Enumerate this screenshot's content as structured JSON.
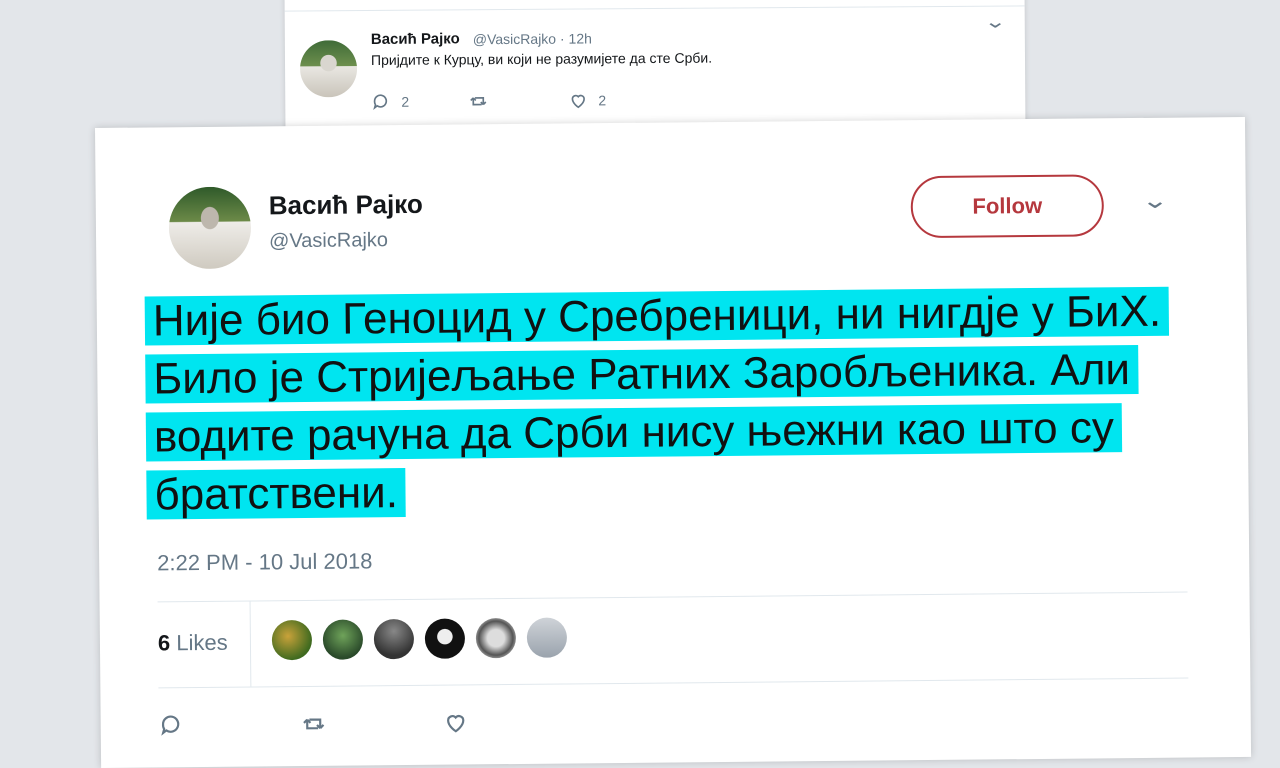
{
  "back_tweet": {
    "name": "Васић Рајко",
    "handle": "@VasicRajko",
    "time": "· 12h",
    "text": "Пријдите к Курцу, ви који не разумијете да сте Срби.",
    "reply_count": "2",
    "like_count": "2",
    "icons": [
      "reply-icon",
      "retweet-icon",
      "heart-icon",
      "chevron-down-icon"
    ]
  },
  "main_tweet": {
    "name": "Васић Рајко",
    "handle": "@VasicRajko",
    "follow_label": "Follow",
    "text": "Није био Геноцид у Сребреници, ни нигдје у БиХ. Било је Стријељање Ратних Заробљеника. Али водите рачуна да Срби нису њежни као што су братствени.",
    "timestamp": "2:22 PM - 10 Jul 2018",
    "likes_count": "6",
    "likes_label": "Likes",
    "liker_count": 6,
    "colors": {
      "follow": "#b5383e",
      "highlight": "#00e5f0",
      "muted": "#657786"
    }
  }
}
